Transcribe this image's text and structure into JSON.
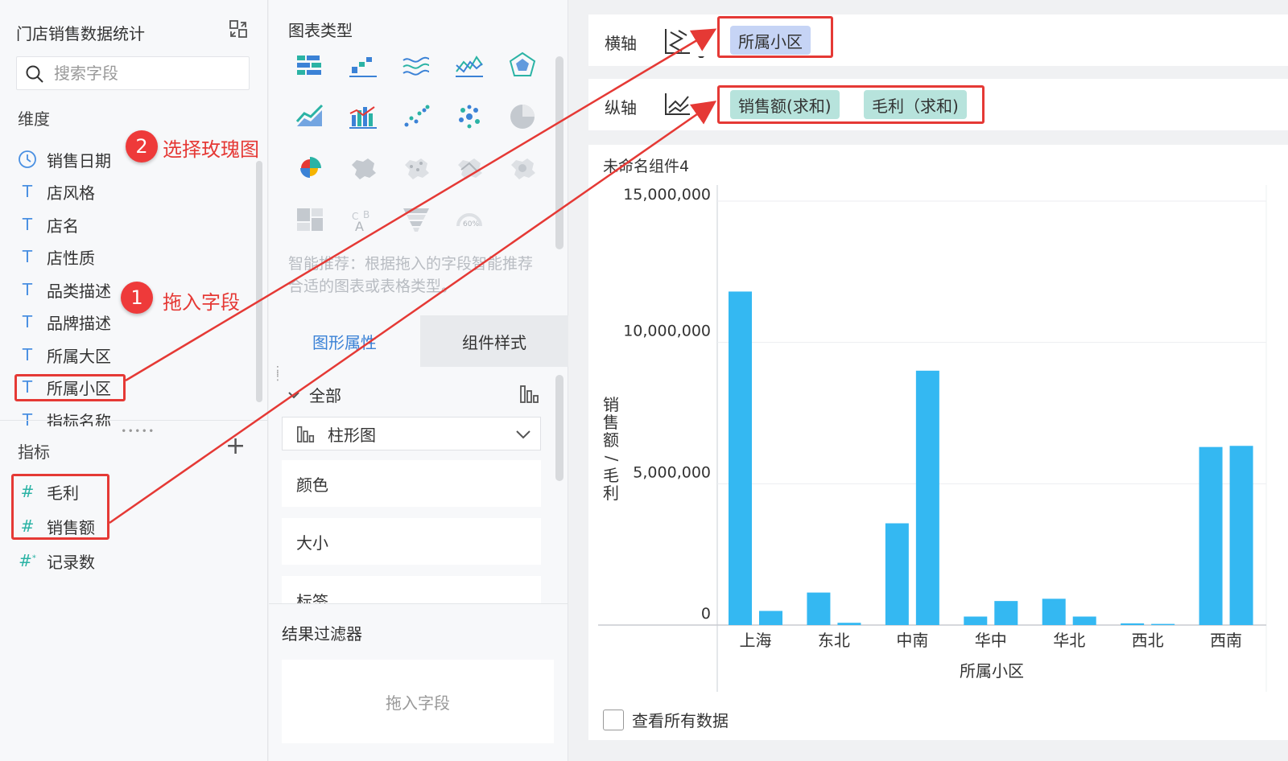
{
  "dataset": {
    "title": "门店销售数据统计"
  },
  "search": {
    "placeholder": "搜索字段"
  },
  "dimensions": {
    "label": "维度",
    "items": [
      {
        "type": "date",
        "label": "销售日期"
      },
      {
        "type": "text",
        "label": "店风格"
      },
      {
        "type": "text",
        "label": "店名"
      },
      {
        "type": "text",
        "label": "店性质"
      },
      {
        "type": "text",
        "label": "品类描述"
      },
      {
        "type": "text",
        "label": "品牌描述"
      },
      {
        "type": "text",
        "label": "所属大区"
      },
      {
        "type": "text",
        "label": "所属小区"
      },
      {
        "type": "text",
        "label": "指标名称"
      }
    ]
  },
  "measures": {
    "label": "指标",
    "items": [
      {
        "type": "number",
        "label": "毛利"
      },
      {
        "type": "number",
        "label": "销售额"
      },
      {
        "type": "number-calc",
        "label": "记录数"
      }
    ]
  },
  "chart_types": {
    "title": "图表类型"
  },
  "hint": "智能推荐：根据拖入的字段智能推荐合适的图表或表格类型。",
  "tabs": {
    "active": "图形属性",
    "inactive": "组件样式"
  },
  "properties": {
    "all_label": "全部",
    "chart_select": "柱形图",
    "items": [
      "颜色",
      "大小",
      "标签"
    ]
  },
  "filter": {
    "title": "结果过滤器",
    "placeholder": "拖入字段"
  },
  "x_axis": {
    "label": "横轴",
    "fields": [
      "所属小区"
    ]
  },
  "y_axis": {
    "label": "纵轴",
    "fields": [
      "销售额(求和)",
      "毛利（求和)"
    ]
  },
  "component": {
    "title": "未命名组件4"
  },
  "view_all": "查看所有数据",
  "annotations": {
    "step1": {
      "num": "1",
      "text": "拖入字段"
    },
    "step2": {
      "num": "2",
      "text": "选择玫瑰图"
    }
  },
  "colors": {
    "accent": "#3b82d6",
    "bar": "#34b8f2",
    "annotation": "#e53935"
  },
  "chart_data": {
    "type": "bar",
    "categories": [
      "上海",
      "东北",
      "中南",
      "华中",
      "华北",
      "西北",
      "西南"
    ],
    "series": [
      {
        "values": [
          11800000,
          1150000,
          3600000,
          300000,
          930000,
          60000,
          6300000
        ]
      },
      {
        "values": [
          500000,
          80000,
          9000000,
          850000,
          300000,
          40000,
          6340000
        ]
      }
    ],
    "ylabel": "销售额/毛利",
    "xlabel": "所属小区",
    "yticks": [
      "15,000,000",
      "10,000,000",
      "5,000,000",
      "0"
    ],
    "ylim": [
      0,
      15000000
    ],
    "grid": true
  }
}
